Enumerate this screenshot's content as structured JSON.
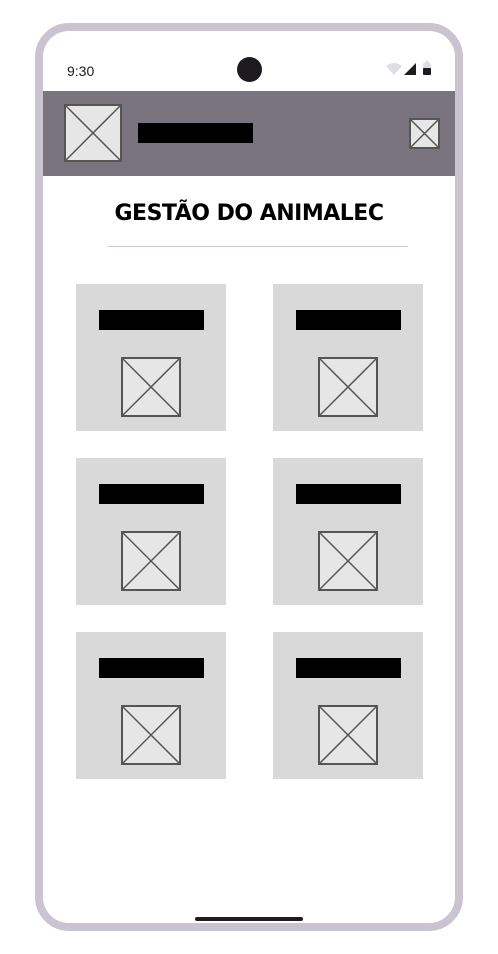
{
  "status_bar": {
    "time": "9:30",
    "icons": [
      "wifi-icon",
      "signal-icon",
      "battery-icon"
    ]
  },
  "app_bar": {
    "logo": "image-placeholder-icon",
    "menu": "image-placeholder-icon"
  },
  "page": {
    "title": "GESTÃO DO ANIMALEC"
  },
  "cards": [
    {
      "icon": "image-placeholder-icon"
    },
    {
      "icon": "image-placeholder-icon"
    },
    {
      "icon": "image-placeholder-icon"
    },
    {
      "icon": "image-placeholder-icon"
    },
    {
      "icon": "image-placeholder-icon"
    },
    {
      "icon": "image-placeholder-icon"
    }
  ],
  "colors": {
    "frame": "#cac4d0",
    "app_bar": "#79747e",
    "card": "#d9d9d9",
    "placeholder_fill": "#e6e6e6",
    "placeholder_stroke": "#555555",
    "text": "#000000"
  }
}
